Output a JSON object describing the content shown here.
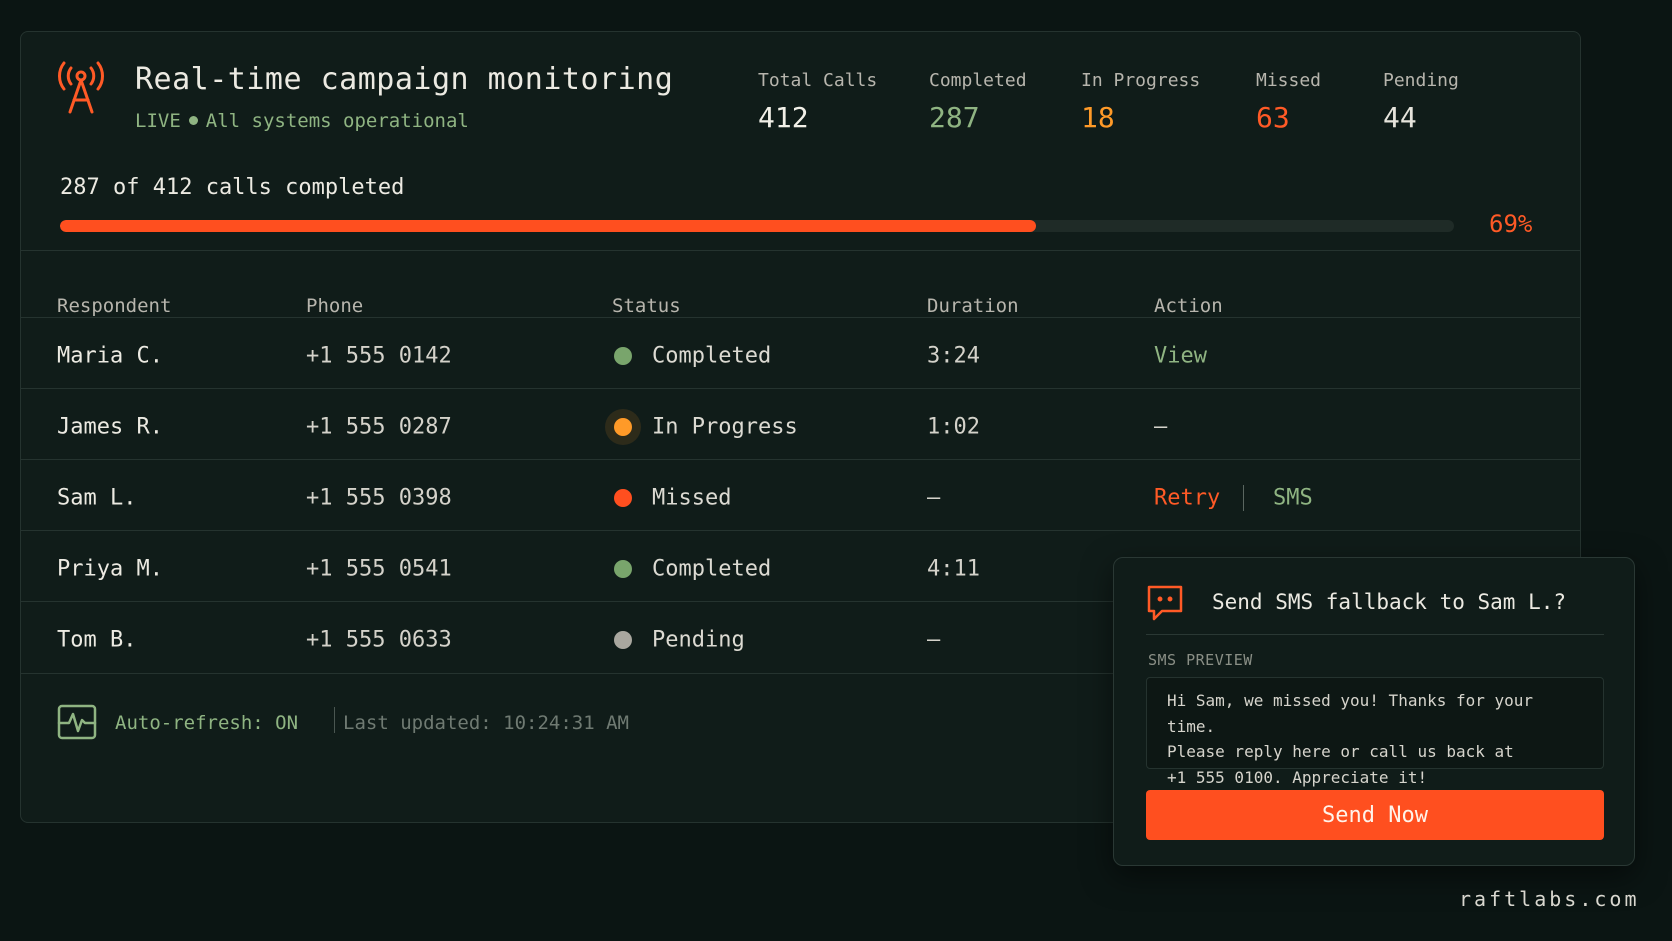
{
  "header": {
    "title": "Real-time campaign monitoring",
    "live_label": "LIVE",
    "status_text": "All systems operational",
    "icon": "antenna-tower-icon"
  },
  "stats": [
    {
      "label": "Total Calls",
      "value": "412",
      "color": "#f2f0e8"
    },
    {
      "label": "Completed",
      "value": "287",
      "color": "#8fb482"
    },
    {
      "label": "In Progress",
      "value": "18",
      "color": "#ff9a28"
    },
    {
      "label": "Missed",
      "value": "63",
      "color": "#ff5a26"
    },
    {
      "label": "Pending",
      "value": "44",
      "color": "#e6e4dc"
    }
  ],
  "progress": {
    "label": "287 of 412 calls completed",
    "percent_text": "69%",
    "fraction": 0.7
  },
  "table": {
    "headers": [
      "Respondent",
      "Phone",
      "Status",
      "Duration",
      "Action"
    ],
    "rows": [
      {
        "name": "Maria C.",
        "phone": "+1 555 0142",
        "status": "Completed",
        "status_color": "#79a56c",
        "duration": "3:24",
        "action": "View",
        "action_color": "#8fb482"
      },
      {
        "name": "James R.",
        "phone": "+1 555 0287",
        "status": "In Progress",
        "status_color": "#ff9a28",
        "duration": "1:02",
        "action": "—",
        "action_color": "#d4d2ca"
      },
      {
        "name": "Sam L.",
        "phone": "+1 555 0398",
        "status": "Missed",
        "status_color": "#ff4f1f",
        "duration": "—",
        "action": "Retry",
        "action_color": "#ff5a26",
        "action2": "SMS",
        "action2_color": "#8fb482"
      },
      {
        "name": "Priya M.",
        "phone": "+1 555 0541",
        "status": "Completed",
        "status_color": "#79a56c",
        "duration": "4:11",
        "action": "",
        "action_color": "#d4d2ca"
      },
      {
        "name": "Tom B.",
        "phone": "+1 555 0633",
        "status": "Pending",
        "status_color": "#a9a79f",
        "duration": "—",
        "action": "",
        "action_color": "#d4d2ca"
      }
    ]
  },
  "footer": {
    "auto_refresh": "Auto-refresh: ON",
    "last_updated": "Last updated: 10:24:31 AM",
    "icon": "activity-pulse-icon"
  },
  "sms_popup": {
    "title": "Send SMS fallback to Sam L.?",
    "preview_label": "SMS PREVIEW",
    "preview_lines": [
      "Hi Sam, we missed you! Thanks for your time.",
      "Please reply here or call us back at",
      "+1 555 0100. Appreciate it!"
    ],
    "send_label": "Send Now",
    "icon": "chat-bubble-icon"
  },
  "brand": "raftlabs.com",
  "colors": {
    "accent": "#ff4f1f",
    "green": "#8fb482",
    "background": "#0b1513",
    "panel": "#101c19"
  }
}
